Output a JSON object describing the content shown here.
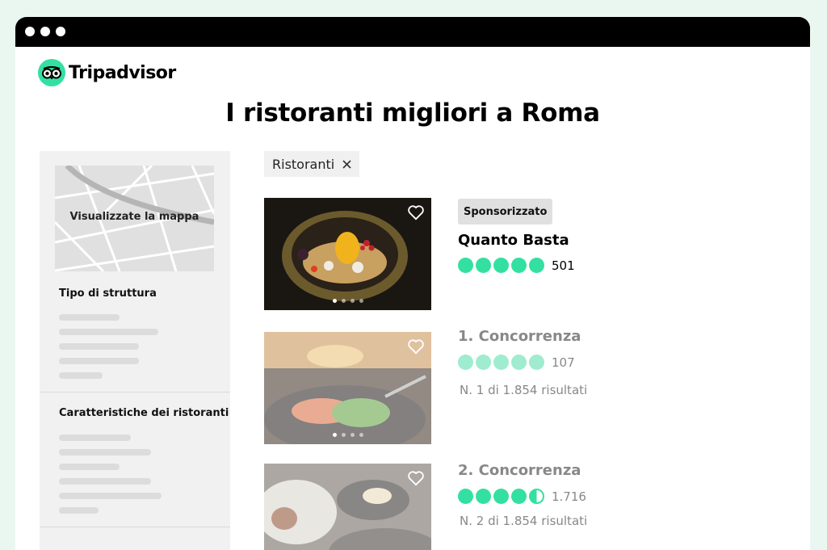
{
  "app": {
    "name": "Tripadvisor"
  },
  "page": {
    "title": "I ristoranti migliori a Roma"
  },
  "sidebar": {
    "map_label": "Visualizzate la mappa",
    "sections": [
      {
        "heading": "Tipo di struttura"
      },
      {
        "heading": "Caratteristiche dei ristoranti"
      }
    ]
  },
  "filter_chip": {
    "label": "Ristoranti",
    "remove_icon": "close-icon"
  },
  "colors": {
    "brand": "#34e0a1",
    "bubble_faded": "#9fecd0",
    "text_muted": "#888888"
  },
  "listings": [
    {
      "badge": "Sponsorizzato",
      "name": "Quanto Basta",
      "rating": 5,
      "reviews": "501",
      "rank": "",
      "faded": false
    },
    {
      "badge": "",
      "name": "1. Concorrenza",
      "rating": 5,
      "reviews": "107",
      "rank": "N. 1 di 1.854 risultati",
      "faded": true
    },
    {
      "badge": "",
      "name": "2. Concorrenza",
      "rating": 4.5,
      "reviews": "1.716",
      "rank": "N. 2 di 1.854 risultati",
      "faded": true
    }
  ]
}
